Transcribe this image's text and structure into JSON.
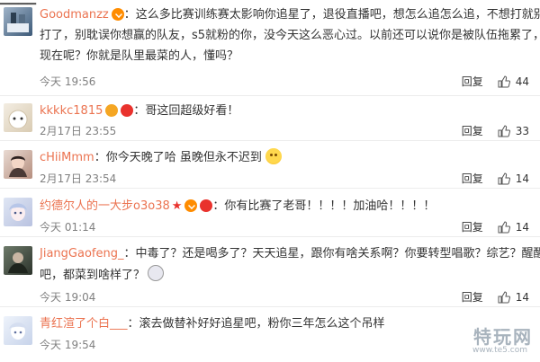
{
  "comments": [
    {
      "username": "Goodmanzz",
      "lines": [
        "：这么多比赛训练赛太影响你追星了，退役直播吧，想怎么追怎么追，不想打就别",
        "打了，别耽误你想赢的队友，s5就粉的你，没今天这么恶心过。以前还可以说你是被队伍拖累了，",
        "现在呢？你就是队里最菜的人，懂吗？"
      ],
      "time": "今天 19:56",
      "reply": "回复",
      "likes": "44"
    },
    {
      "username": "kkkkc18",
      "level": "15",
      "lines": [
        "：哥这回超级好看！"
      ],
      "time": "2月17日 23:55",
      "reply": "回复",
      "likes": "33"
    },
    {
      "username": "cHiiMmm",
      "lines": [
        "：你今天晚了哈 虽晚但永不迟到"
      ],
      "time": "2月17日 23:54",
      "reply": "回复",
      "likes": "14"
    },
    {
      "username": "约德尔人的一大步o3o",
      "level": "38",
      "lines": [
        "：你有比赛了老哥！！！！加油哈！！！！"
      ],
      "time": "今天 01:14",
      "reply": "回复",
      "likes": "14"
    },
    {
      "username": "JiangGaofeng_",
      "lines": [
        "：中毒了？还是喝多了？天天追星，跟你有啥关系啊？你要转型唱歌？综艺？醒醒",
        "吧，都菜到啥样了？"
      ],
      "time": "今天 19:04",
      "reply": "回复",
      "likes": "14"
    },
    {
      "username": "青红渲了个白___",
      "lines": [
        "：滚去做替补好好追星吧，粉你三年怎么这个吊样"
      ],
      "time": "今天 19:54",
      "reply": "回复",
      "likes": ""
    }
  ],
  "watermark": {
    "text": "特玩网",
    "url": "www.te5.com"
  },
  "colors": {
    "username": "#eb7350",
    "meta": "#808080",
    "divider": "#ececec"
  }
}
